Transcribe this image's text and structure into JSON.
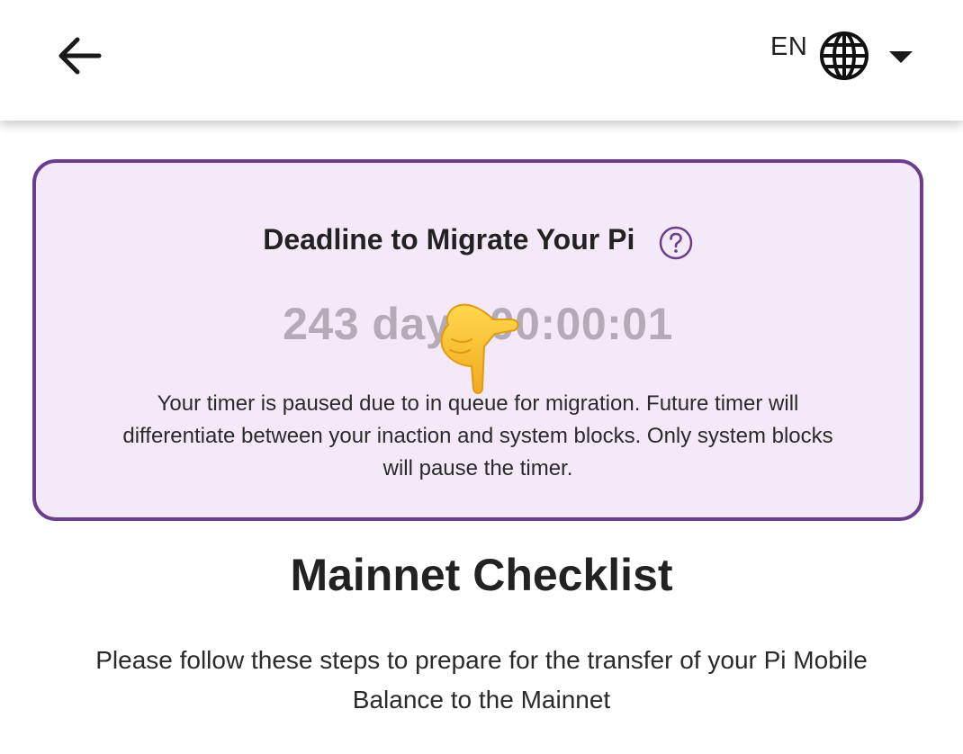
{
  "header": {
    "back_icon": "arrow-left-icon",
    "language": "EN",
    "globe_icon": "globe-icon",
    "dropdown_icon": "chevron-down-icon"
  },
  "deadline": {
    "title": "Deadline to Migrate Your Pi",
    "help_icon": "question-circle-icon",
    "countdown": "243 days 00:00:01",
    "overlay_icon": "pointing-hand-emoji",
    "note": "Your timer is paused due to in queue for migration. Future timer will differentiate between your inaction and system blocks. Only system blocks will pause the timer."
  },
  "checklist": {
    "title": "Mainnet Checklist",
    "description": "Please follow these steps to prepare for the transfer of your Pi Mobile Balance to the Mainnet"
  },
  "colors": {
    "card_border": "#6a3e8c",
    "card_background": "#f3e9f8",
    "countdown_text": "#b3abb8"
  }
}
